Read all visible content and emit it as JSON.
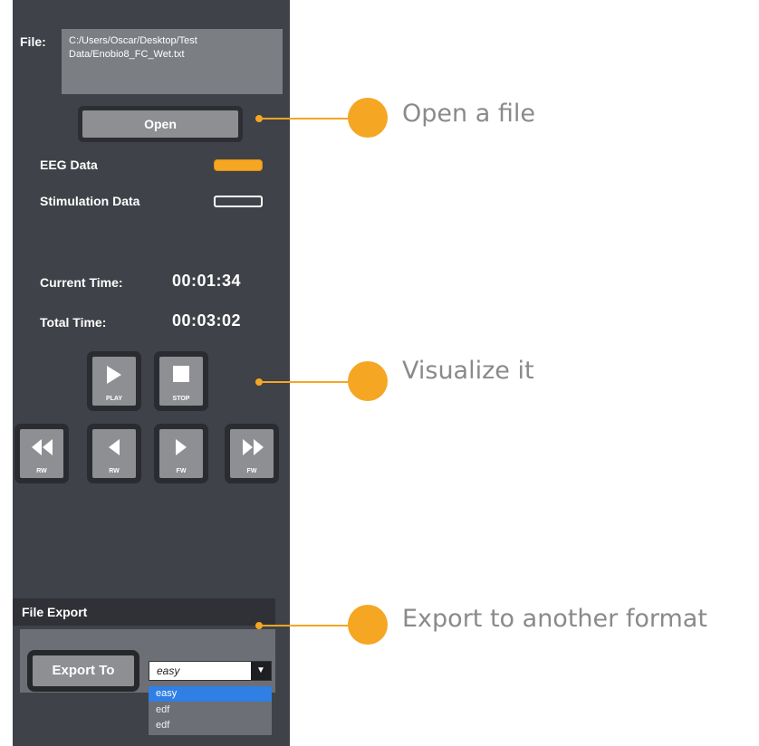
{
  "file": {
    "label": "File:",
    "path_line1": "C:/Users/Oscar/Desktop/Test",
    "path_line2": "Data/Enobio8_FC_Wet.txt",
    "open_label": "Open"
  },
  "legend": {
    "eeg_label": "EEG Data",
    "eeg_color": "#f5a623",
    "stim_label": "Stimulation Data"
  },
  "time": {
    "current_label": "Current Time:",
    "current_value": "00:01:34",
    "total_label": "Total Time:",
    "total_value": "00:03:02"
  },
  "controls": {
    "play": "PLAY",
    "stop": "STOP",
    "fast_rewind": "RW",
    "rewind": "RW",
    "forward": "FW",
    "fast_forward": "FW"
  },
  "export": {
    "title": "File Export",
    "button_label": "Export To",
    "selected": "easy",
    "options": [
      "easy",
      "edf",
      "edf"
    ]
  },
  "callouts": {
    "open": "Open a file",
    "visualize": "Visualize it",
    "export": "Export to another format"
  }
}
